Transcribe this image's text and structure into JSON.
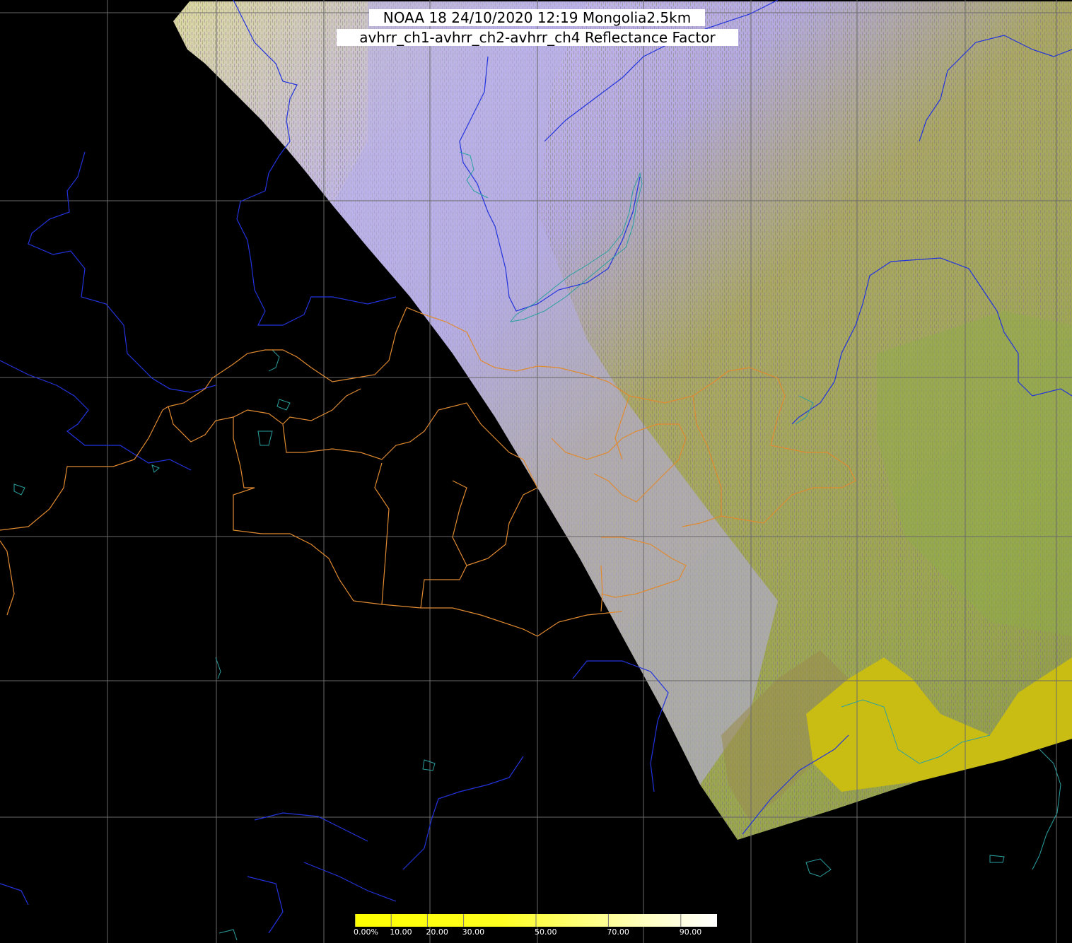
{
  "header": {
    "title_line1": "NOAA 18 24/10/2020 12:19 Mongolia2.5km",
    "title_line2": "avhrr_ch1-avhrr_ch2-avhrr_ch4 Reflectance Factor"
  },
  "colorbar": {
    "ticks": [
      "0.00%",
      "10.00",
      "20.00",
      "30.00",
      "50.00",
      "70.00",
      "90.00"
    ],
    "tick_values": [
      0,
      10,
      20,
      30,
      50,
      70,
      90
    ],
    "range": [
      0,
      100
    ],
    "colors": [
      "#ffff00",
      "#ffff66",
      "#ffffaa",
      "#ffffff"
    ]
  },
  "map": {
    "background": "#000000",
    "grid_color": "#6a6a6a",
    "river_color": "#2233dd",
    "lake_color": "#2aa0a0",
    "border_color": "#e08a30",
    "swath_colors": {
      "cloud_yellow": "#d8d49a",
      "cloud_lavender": "#b8aef0",
      "terrain_olive": "#a9a85a",
      "terrain_green": "#8ea84a",
      "coast_yellow": "#c8bd10"
    }
  }
}
